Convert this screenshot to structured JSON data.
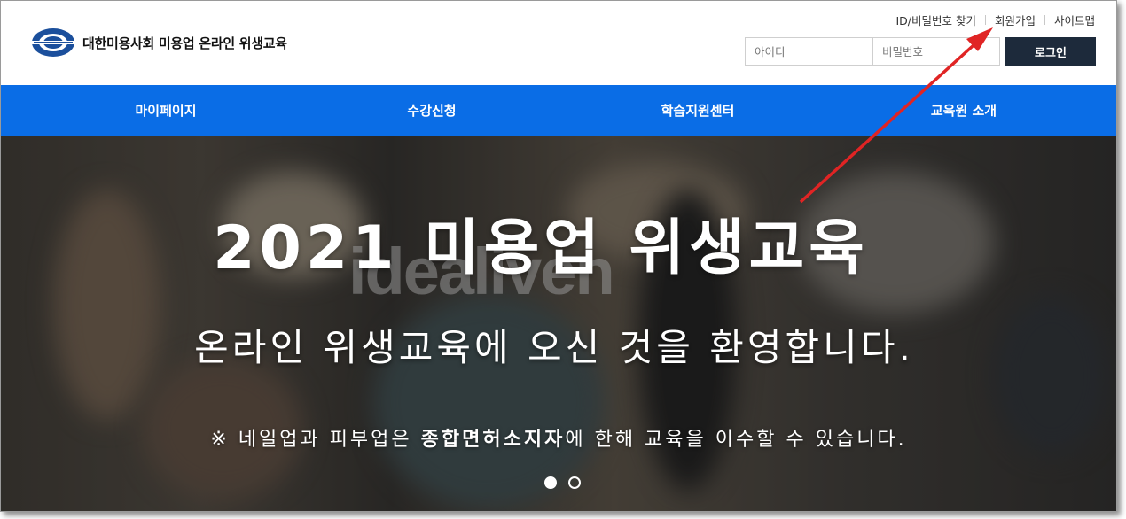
{
  "header": {
    "site_title": "대한미용사회 미용업 온라인 위생교육",
    "util_links": [
      {
        "label": "ID/비밀번호 찾기"
      },
      {
        "label": "회원가입"
      },
      {
        "label": "사이트맵"
      }
    ],
    "login": {
      "id_placeholder": "아이디",
      "pw_placeholder": "비밀번호",
      "button": "로그인"
    }
  },
  "nav": {
    "items": [
      {
        "label": "마이페이지"
      },
      {
        "label": "수강신청"
      },
      {
        "label": "학습지원센터"
      },
      {
        "label": "교육원 소개"
      }
    ]
  },
  "hero": {
    "title": "2021 미용업 위생교육",
    "subtitle": "온라인 위생교육에 오신 것을 환영합니다.",
    "note_prefix": "※ 네일업과 피부업은 ",
    "note_bold": "종합면허소지자",
    "note_suffix": "에 한해 교육을 이수할 수 있습니다.",
    "watermark": "idealiven",
    "slides": 2,
    "active_slide": 1
  },
  "colors": {
    "nav_bg": "#0a6de6",
    "login_button_bg": "#1d2a3b",
    "annotation_arrow": "#e02424"
  },
  "icons": [
    "logo-emblem-icon",
    "slide-dot-icon",
    "annotation-arrow-icon"
  ]
}
